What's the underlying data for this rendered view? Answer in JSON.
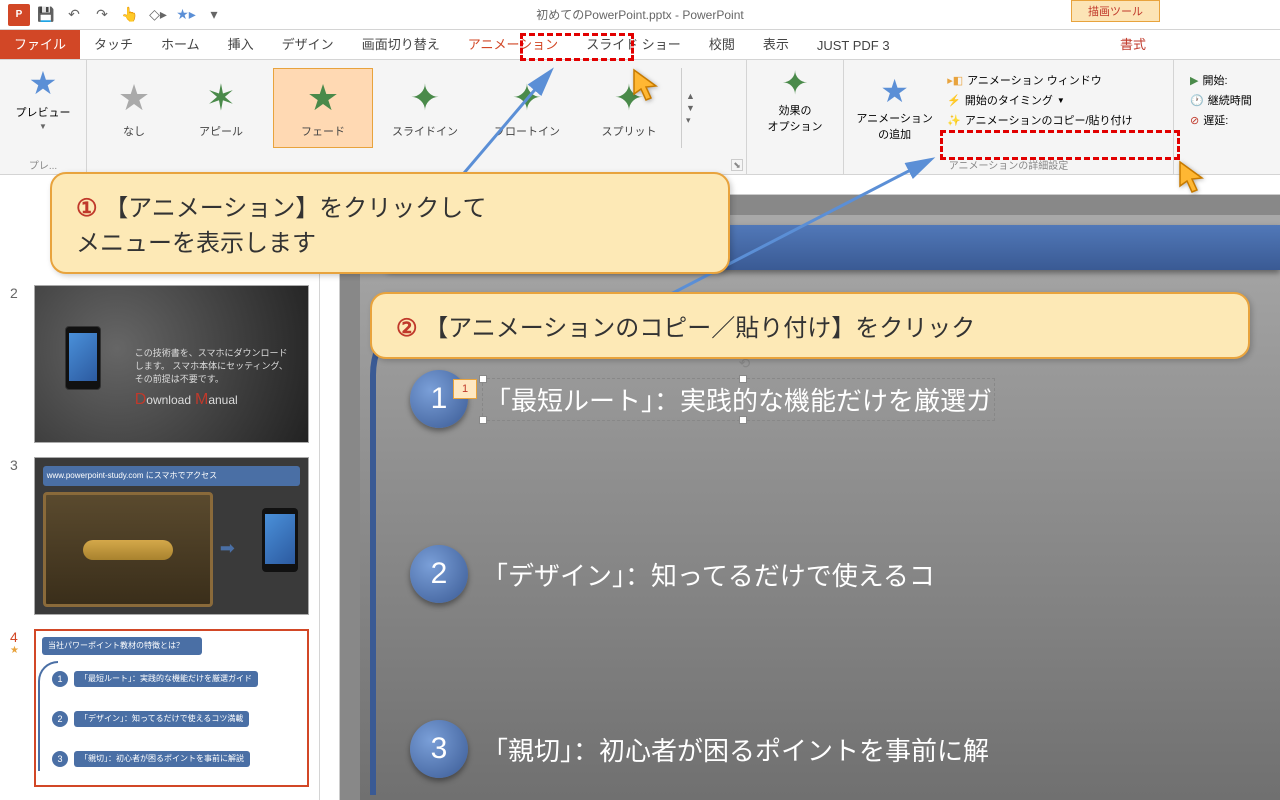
{
  "title": "初めてのPowerPoint.pptx - PowerPoint",
  "tool_context": "描画ツール",
  "tabs": {
    "file": "ファイル",
    "touch": "タッチ",
    "home": "ホーム",
    "insert": "挿入",
    "design": "デザイン",
    "transitions": "画面切り替え",
    "animations": "アニメーション",
    "slideshow": "スライド ショー",
    "review": "校閲",
    "view": "表示",
    "justpdf": "JUST PDF 3",
    "format": "書式"
  },
  "ribbon": {
    "preview": "プレビュー",
    "preview_group": "プレ...",
    "anims": {
      "none": "なし",
      "appear": "アピール",
      "fade": "フェード",
      "slidein": "スライドイン",
      "floatin": "フロートイン",
      "split": "スプリット"
    },
    "effect_options": "効果の\nオプション",
    "add_animation": "アニメーション\nの追加",
    "anim_pane": "アニメーション ウィンドウ",
    "trigger": "開始のタイミング",
    "painter": "アニメーションのコピー/貼り付け",
    "adv_group": "アニメーションの詳細設定",
    "start": "開始:",
    "duration": "継続時間",
    "delay": "遅延:"
  },
  "callouts": {
    "c1_num": "①",
    "c1_text": "【アニメーション】をクリックして\nメニューを表示します",
    "c2_num": "②",
    "c2_text": "【アニメーションのコピー／貼り付け】をクリック"
  },
  "slides": {
    "n2": "2",
    "n3": "3",
    "n4": "4",
    "thumb2_text": "この技術書を、スマホにダウンロードします。\nスマホ本体にセッティング、その前提は不要です。",
    "thumb2_dl": "Download Manual",
    "thumb3_header": "www.powerpoint-study.com にスマホでアクセス",
    "thumb4_header": "当社パワーポイント教材の特徴とは？",
    "thumb4_i1": "「最短ルート」：実践的な機能だけを厳選ガイド",
    "thumb4_i2": "「デザイン」：知ってるだけで使えるコツ満載",
    "thumb4_i3": "「親切」：初心者が困るポイントを事前に解説"
  },
  "content": {
    "anim_tag": "1",
    "item1": "「最短ルート」：実践的な機能だけを厳選ガ",
    "item2": "「デザイン」：知ってるだけで使えるコ",
    "item3": "「親切」：初心者が困るポイントを事前に解"
  }
}
